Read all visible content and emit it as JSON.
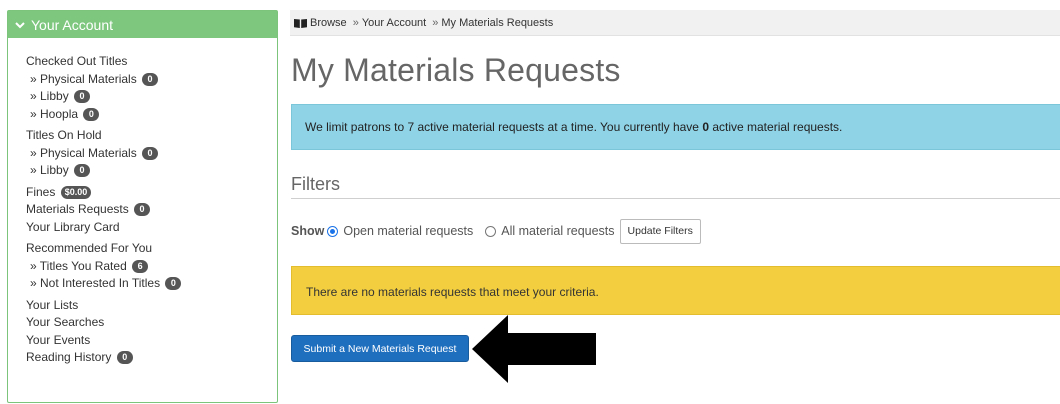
{
  "sidebar": {
    "header_label": "Your Account",
    "checked_out": {
      "title": "Checked Out Titles",
      "physical": {
        "label": "» Physical Materials",
        "count": "0"
      },
      "libby": {
        "label": "» Libby",
        "count": "0"
      },
      "hoopla": {
        "label": "» Hoopla",
        "count": "0"
      }
    },
    "holds": {
      "title": "Titles On Hold",
      "physical": {
        "label": "» Physical Materials",
        "count": "0"
      },
      "libby": {
        "label": "» Libby",
        "count": "0"
      }
    },
    "fines": {
      "label": "Fines",
      "amount": "$0.00"
    },
    "materials_requests": {
      "label": "Materials Requests",
      "count": "0"
    },
    "library_card": "Your Library Card",
    "recommended": {
      "title": "Recommended For You",
      "rated": {
        "label": "» Titles You Rated",
        "count": "6"
      },
      "not_interested": {
        "label": "» Not Interested In Titles",
        "count": "0"
      }
    },
    "lists": "Your Lists",
    "searches": "Your Searches",
    "events": "Your Events",
    "reading_history": {
      "label": "Reading History",
      "count": "0"
    }
  },
  "breadcrumb": {
    "browse": "Browse",
    "account": "Your Account",
    "current": "My Materials Requests",
    "separator": "»"
  },
  "main": {
    "title": "My Materials Requests",
    "info_prefix": "We limit patrons to 7 active material requests at a time. You currently have ",
    "info_count": "0",
    "info_suffix": " active material requests.",
    "filters_title": "Filters",
    "show_label": "Show",
    "radio_open": "Open material requests",
    "radio_all": "All material requests",
    "update_button": "Update Filters",
    "empty_message": "There are no materials requests that meet your criteria.",
    "submit_button": "Submit a New Materials Request"
  },
  "colors": {
    "sidebar_header": "#7ec77f",
    "info_alert": "#8fd3e6",
    "warning_alert": "#f3cf3f",
    "primary_button": "#1f6fbf",
    "badge": "#555555"
  }
}
